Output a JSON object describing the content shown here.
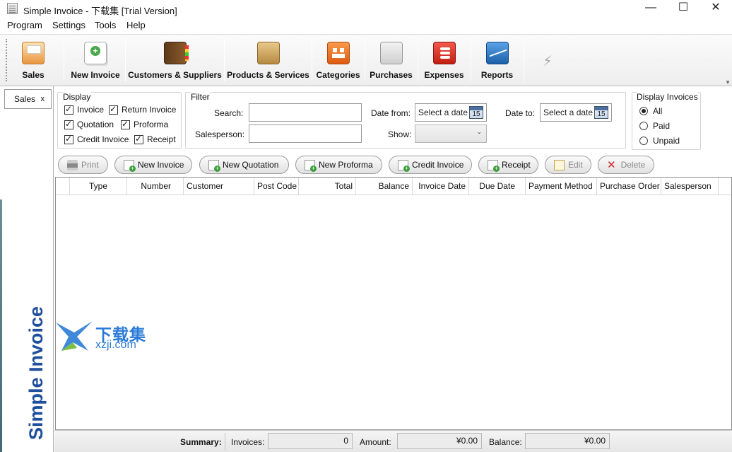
{
  "window": {
    "title": "Simple Invoice - 下载集  [Trial Version]",
    "minimize": "—",
    "maximize": "☐",
    "close": "✕"
  },
  "menu": [
    "Program",
    "Settings",
    "Tools",
    "Help"
  ],
  "toolbar": {
    "buttons": [
      {
        "label": "Sales",
        "icon": "sales-icon"
      },
      {
        "label": "New Invoice",
        "icon": "new-invoice-icon"
      },
      {
        "label": "Customers & Suppliers",
        "icon": "address-book-icon"
      },
      {
        "label": "Products & Services",
        "icon": "box-icon"
      },
      {
        "label": "Categories",
        "icon": "categories-icon"
      },
      {
        "label": "Purchases",
        "icon": "cart-icon"
      },
      {
        "label": "Expenses",
        "icon": "coins-icon"
      },
      {
        "label": "Reports",
        "icon": "chart-icon"
      }
    ]
  },
  "left_panel": {
    "tab_label": "Sales",
    "tab_close": "x",
    "logo_text": "Simple Invoice"
  },
  "display": {
    "legend": "Display",
    "options": [
      {
        "label": "Invoice",
        "checked": true
      },
      {
        "label": "Return Invoice",
        "checked": true
      },
      {
        "label": "Quotation",
        "checked": true
      },
      {
        "label": "Proforma",
        "checked": true
      },
      {
        "label": "Credit Invoice",
        "checked": true
      },
      {
        "label": "Receipt",
        "checked": true
      }
    ]
  },
  "filter": {
    "legend": "Filter",
    "search_label": "Search:",
    "search_value": "",
    "salesperson_label": "Salesperson:",
    "salesperson_value": "",
    "date_from_label": "Date from:",
    "date_from_value": "Select a date",
    "date_to_label": "Date to:",
    "date_to_value": "Select a date",
    "calendar_day": "15",
    "show_label": "Show:",
    "show_value": ""
  },
  "display_invoices": {
    "legend": "Display Invoices",
    "options": [
      {
        "label": "All",
        "selected": true
      },
      {
        "label": "Paid",
        "selected": false
      },
      {
        "label": "Unpaid",
        "selected": false
      }
    ]
  },
  "actions": {
    "print": "Print",
    "new_invoice": "New Invoice",
    "new_quotation": "New Quotation",
    "new_proforma": "New Proforma",
    "credit_invoice": "Credit Invoice",
    "receipt": "Receipt",
    "edit": "Edit",
    "delete": "Delete"
  },
  "grid": {
    "columns": [
      "Type",
      "Number",
      "Customer",
      "Post Code",
      "Total",
      "Balance",
      "Invoice Date",
      "Due Date",
      "Payment Method",
      "Purchase Order",
      "Salesperson"
    ],
    "rows": []
  },
  "summary": {
    "label": "Summary:",
    "invoices_label": "Invoices:",
    "invoices_value": "0",
    "amount_label": "Amount:",
    "amount_value": "¥0.00",
    "balance_label": "Balance:",
    "balance_value": "¥0.00"
  },
  "watermark": {
    "cn": "下载集",
    "url": "xzji.com"
  }
}
